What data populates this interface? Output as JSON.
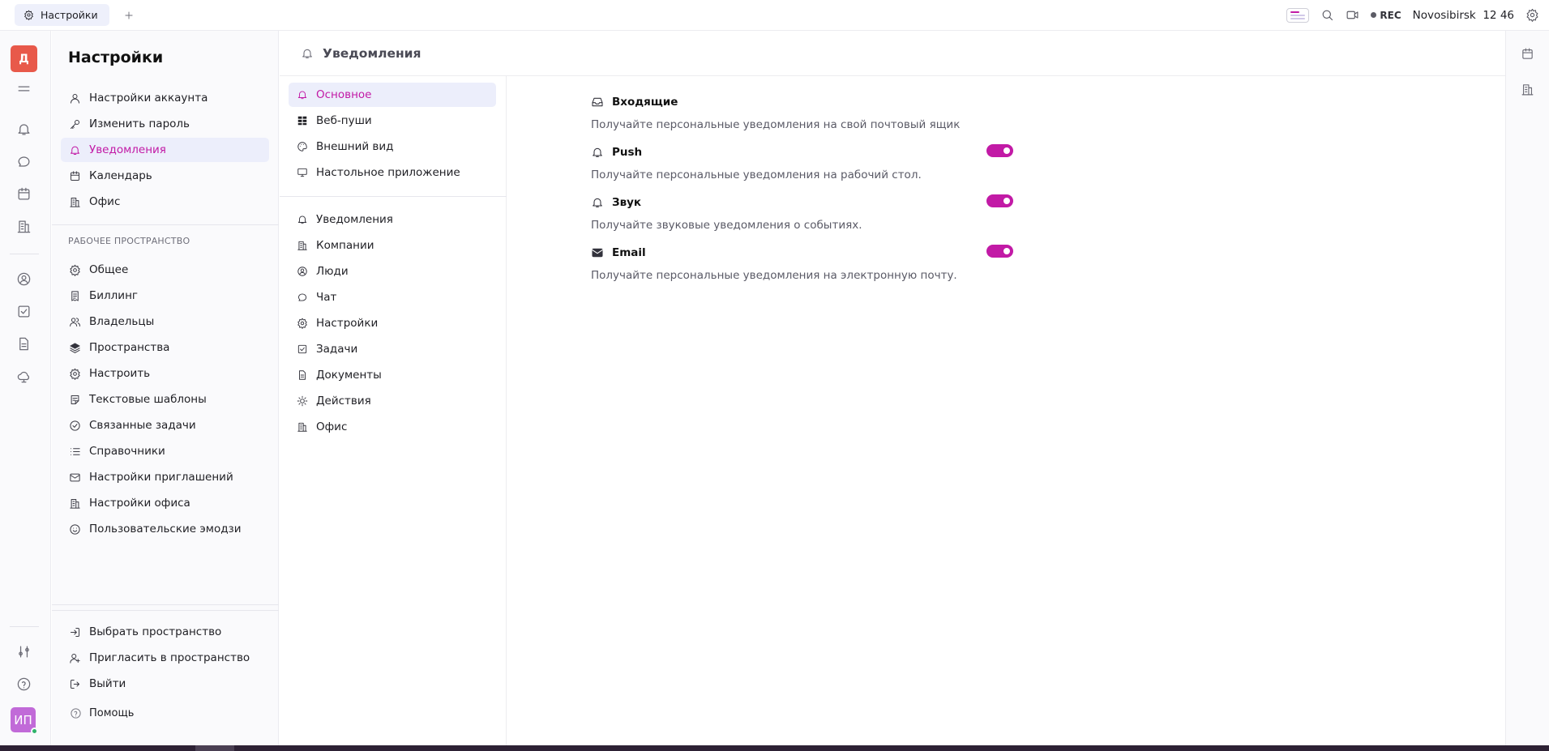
{
  "tab": {
    "label": "Настройки"
  },
  "topbar": {
    "rec_label": "REC",
    "city": "Novosibirsk",
    "time": "12 46"
  },
  "rail": {
    "workspace_initial": "Д",
    "user_initials": "ИП"
  },
  "sidebar": {
    "title": "Настройки",
    "account_items": [
      {
        "label": "Настройки аккаунта"
      },
      {
        "label": "Изменить пароль"
      },
      {
        "label": "Уведомления"
      },
      {
        "label": "Календарь"
      },
      {
        "label": "Офис"
      }
    ],
    "workspace_section": "РАБОЧЕЕ ПРОСТРАНСТВО",
    "workspace_items": [
      {
        "label": "Общее"
      },
      {
        "label": "Биллинг"
      },
      {
        "label": "Владельцы"
      },
      {
        "label": "Пространства"
      },
      {
        "label": "Настроить"
      },
      {
        "label": "Текстовые шаблоны"
      },
      {
        "label": "Связанные задачи"
      },
      {
        "label": "Справочники"
      },
      {
        "label": "Настройки приглашений"
      },
      {
        "label": "Настройки офиса"
      },
      {
        "label": "Пользовательские эмодзи"
      }
    ],
    "bottom_items": [
      {
        "label": "Выбрать пространство"
      },
      {
        "label": "Пригласить в пространство"
      },
      {
        "label": "Выйти"
      }
    ],
    "help_label": "Помощь"
  },
  "content": {
    "title": "Уведомления"
  },
  "subnav": {
    "top_items": [
      {
        "label": "Основное"
      },
      {
        "label": "Веб-пуши"
      },
      {
        "label": "Внешний вид"
      },
      {
        "label": "Настольное приложение"
      }
    ],
    "module_items": [
      {
        "label": "Уведомления"
      },
      {
        "label": "Компании"
      },
      {
        "label": "Люди"
      },
      {
        "label": "Чат"
      },
      {
        "label": "Настройки"
      },
      {
        "label": "Задачи"
      },
      {
        "label": "Документы"
      },
      {
        "label": "Действия"
      },
      {
        "label": "Офис"
      }
    ]
  },
  "settings": [
    {
      "title": "Входящие",
      "description": "Получайте персональные уведомления на свой почтовый ящик",
      "icon": "inbox-icon",
      "has_toggle": false
    },
    {
      "title": "Push",
      "description": "Получайте персональные уведомления на рабочий стол.",
      "icon": "bell-icon",
      "has_toggle": true,
      "enabled": true
    },
    {
      "title": "Звук",
      "description": "Получайте звуковые уведомления о событиях.",
      "icon": "bell-icon",
      "has_toggle": true,
      "enabled": true
    },
    {
      "title": "Email",
      "description": "Получайте персональные уведомления на электронную почту.",
      "icon": "envelope-icon",
      "has_toggle": true,
      "enabled": true
    }
  ],
  "colors": {
    "accent": "#c21aa6",
    "active_bg": "#eceefb",
    "workspace_avatar": "#e8594a",
    "user_avatar": "#c16ad8"
  }
}
